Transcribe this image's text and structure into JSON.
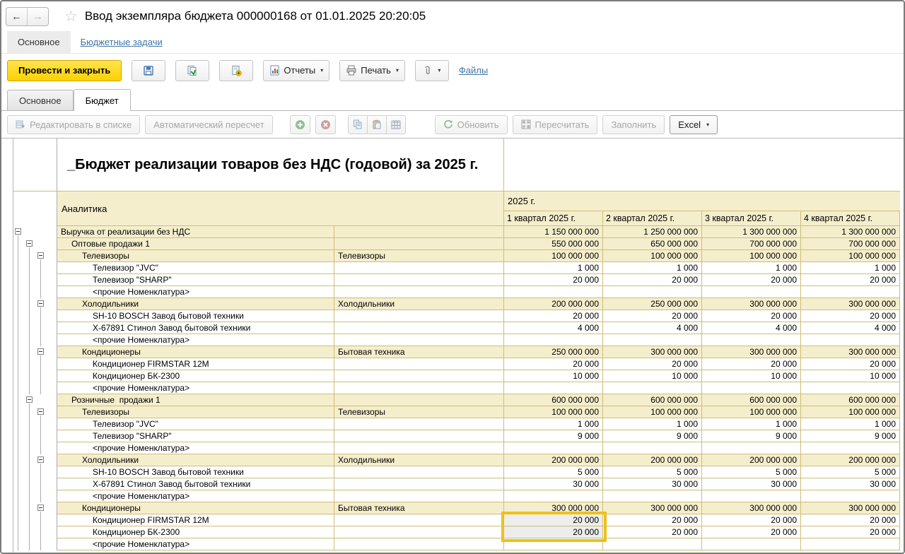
{
  "window": {
    "title": "Ввод экземпляра бюджета 000000168 от 01.01.2025 20:20:05"
  },
  "icons": {
    "back": "←",
    "forward": "→",
    "star": "☆",
    "caret": "▾"
  },
  "nav": {
    "main_tab": "Основное",
    "tasks_link": "Бюджетные задачи"
  },
  "toolbar": {
    "post_close": "Провести и закрыть",
    "reports": "Отчеты",
    "print": "Печать",
    "files": "Файлы"
  },
  "form_tabs": {
    "main": "Основное",
    "budget": "Бюджет"
  },
  "table_toolbar": {
    "edit_list": "Редактировать в списке",
    "auto_recalc": "Автоматический пересчет",
    "refresh": "Обновить",
    "recalc": "Пересчитать",
    "fill": "Заполнить",
    "excel": "Excel"
  },
  "report": {
    "title": "_Бюджет реализации товаров без НДС (годовой) за 2025 г.",
    "analytics": "Аналитика",
    "year": "2025 г.",
    "quarters": [
      "1 квартал 2025 г.",
      "2 квартал 2025 г.",
      "3 квартал 2025 г.",
      "4 квартал 2025 г."
    ]
  },
  "colors": {
    "accent_yellow": "#ffd500",
    "selection_border": "#eec01d",
    "selected_cell_bg": "#ededed",
    "link": "#3e76a8",
    "group_row_bg": "#f5eecd",
    "grid_line": "#ccbe79"
  },
  "selection": {
    "column": "1 квартал 2025 г.",
    "row_labels": [
      "Кондиционер FIRMSTAR 12M",
      "Кондиционер БК-2300"
    ],
    "values": [
      "20 000",
      "20 000"
    ]
  },
  "rows": [
    {
      "t": "Выручка от реализации без НДС",
      "t2": "",
      "v": [
        "1 150 000 000",
        "1 250 000 000",
        "1 300 000 000",
        "1 300 000 000"
      ],
      "lv": 0,
      "g": true,
      "box": 0,
      "pass": []
    },
    {
      "t": "Оптовые продажи 1",
      "t2": "",
      "v": [
        "550 000 000",
        "650 000 000",
        "700 000 000",
        "700 000 000"
      ],
      "lv": 1,
      "g": true,
      "box": 1,
      "pass": [
        0
      ]
    },
    {
      "t": "Телевизоры",
      "t2": "Телевизоры",
      "v": [
        "100 000 000",
        "100 000 000",
        "100 000 000",
        "100 000 000"
      ],
      "lv": 2,
      "g": true,
      "box": 2,
      "pass": [
        0,
        1
      ]
    },
    {
      "t": "Телевизор \"JVC\"",
      "t2": "",
      "v": [
        "1 000",
        "1 000",
        "1 000",
        "1 000"
      ],
      "lv": 3,
      "g": false,
      "box": -1,
      "pass": [
        0,
        1,
        2
      ]
    },
    {
      "t": "Телевизор \"SHARP\"",
      "t2": "",
      "v": [
        "20 000",
        "20 000",
        "20 000",
        "20 000"
      ],
      "lv": 3,
      "g": false,
      "box": -1,
      "pass": [
        0,
        1,
        2
      ]
    },
    {
      "t": "<прочие Номенклатура>",
      "t2": "",
      "v": [
        "",
        "",
        "",
        ""
      ],
      "lv": 3,
      "g": false,
      "box": -1,
      "pass": [
        0,
        1,
        2
      ]
    },
    {
      "t": "Холодильники",
      "t2": "Холодильники",
      "v": [
        "200 000 000",
        "250 000 000",
        "300 000 000",
        "300 000 000"
      ],
      "lv": 2,
      "g": true,
      "box": 2,
      "pass": [
        0,
        1
      ]
    },
    {
      "t": "SH-10 BOSCH Завод бытовой техники",
      "t2": "",
      "v": [
        "20 000",
        "20 000",
        "20 000",
        "20 000"
      ],
      "lv": 3,
      "g": false,
      "box": -1,
      "pass": [
        0,
        1,
        2
      ]
    },
    {
      "t": "X-67891 Стинол Завод бытовой техники",
      "t2": "",
      "v": [
        "4 000",
        "4 000",
        "4 000",
        "4 000"
      ],
      "lv": 3,
      "g": false,
      "box": -1,
      "pass": [
        0,
        1,
        2
      ]
    },
    {
      "t": "<прочие Номенклатура>",
      "t2": "",
      "v": [
        "",
        "",
        "",
        ""
      ],
      "lv": 3,
      "g": false,
      "box": -1,
      "pass": [
        0,
        1,
        2
      ]
    },
    {
      "t": "Кондиционеры",
      "t2": "Бытовая техника",
      "v": [
        "250 000 000",
        "300 000 000",
        "300 000 000",
        "300 000 000"
      ],
      "lv": 2,
      "g": true,
      "box": 2,
      "pass": [
        0,
        1
      ]
    },
    {
      "t": "Кондиционер FIRMSTAR 12M",
      "t2": "",
      "v": [
        "20 000",
        "20 000",
        "20 000",
        "20 000"
      ],
      "lv": 3,
      "g": false,
      "box": -1,
      "pass": [
        0,
        1,
        2
      ]
    },
    {
      "t": "Кондиционер БК-2300",
      "t2": "",
      "v": [
        "10 000",
        "10 000",
        "10 000",
        "10 000"
      ],
      "lv": 3,
      "g": false,
      "box": -1,
      "pass": [
        0,
        1,
        2
      ]
    },
    {
      "t": "<прочие Номенклатура>",
      "t2": "",
      "v": [
        "",
        "",
        "",
        ""
      ],
      "lv": 3,
      "g": false,
      "box": -1,
      "pass": [
        0,
        1,
        2
      ]
    },
    {
      "t": "Розничные  продажи 1",
      "t2": "",
      "v": [
        "600 000 000",
        "600 000 000",
        "600 000 000",
        "600 000 000"
      ],
      "lv": 1,
      "g": true,
      "box": 1,
      "pass": [
        0
      ]
    },
    {
      "t": "Телевизоры",
      "t2": "Телевизоры",
      "v": [
        "100 000 000",
        "100 000 000",
        "100 000 000",
        "100 000 000"
      ],
      "lv": 2,
      "g": true,
      "box": 2,
      "pass": [
        0,
        1
      ]
    },
    {
      "t": "Телевизор \"JVC\"",
      "t2": "",
      "v": [
        "1 000",
        "1 000",
        "1 000",
        "1 000"
      ],
      "lv": 3,
      "g": false,
      "box": -1,
      "pass": [
        0,
        1,
        2
      ]
    },
    {
      "t": "Телевизор \"SHARP\"",
      "t2": "",
      "v": [
        "9 000",
        "9 000",
        "9 000",
        "9 000"
      ],
      "lv": 3,
      "g": false,
      "box": -1,
      "pass": [
        0,
        1,
        2
      ]
    },
    {
      "t": "<прочие Номенклатура>",
      "t2": "",
      "v": [
        "",
        "",
        "",
        ""
      ],
      "lv": 3,
      "g": false,
      "box": -1,
      "pass": [
        0,
        1,
        2
      ]
    },
    {
      "t": "Холодильники",
      "t2": "Холодильники",
      "v": [
        "200 000 000",
        "200 000 000",
        "200 000 000",
        "200 000 000"
      ],
      "lv": 2,
      "g": true,
      "box": 2,
      "pass": [
        0,
        1
      ]
    },
    {
      "t": "SH-10 BOSCH Завод бытовой техники",
      "t2": "",
      "v": [
        "5 000",
        "5 000",
        "5 000",
        "5 000"
      ],
      "lv": 3,
      "g": false,
      "box": -1,
      "pass": [
        0,
        1,
        2
      ]
    },
    {
      "t": "X-67891 Стинол Завод бытовой техники",
      "t2": "",
      "v": [
        "30 000",
        "30 000",
        "30 000",
        "30 000"
      ],
      "lv": 3,
      "g": false,
      "box": -1,
      "pass": [
        0,
        1,
        2
      ]
    },
    {
      "t": "<прочие Номенклатура>",
      "t2": "",
      "v": [
        "",
        "",
        "",
        ""
      ],
      "lv": 3,
      "g": false,
      "box": -1,
      "pass": [
        0,
        1,
        2
      ]
    },
    {
      "t": "Кондиционеры",
      "t2": "Бытовая техника",
      "v": [
        "300 000 000",
        "300 000 000",
        "300 000 000",
        "300 000 000"
      ],
      "lv": 2,
      "g": true,
      "box": 2,
      "pass": [
        0,
        1
      ]
    },
    {
      "t": "Кондиционер FIRMSTAR 12M",
      "t2": "",
      "v": [
        "20 000",
        "20 000",
        "20 000",
        "20 000"
      ],
      "lv": 3,
      "g": false,
      "box": -1,
      "pass": [
        0,
        1,
        2
      ],
      "sel": 0
    },
    {
      "t": "Кондиционер БК-2300",
      "t2": "",
      "v": [
        "20 000",
        "20 000",
        "20 000",
        "20 000"
      ],
      "lv": 3,
      "g": false,
      "box": -1,
      "pass": [
        0,
        1,
        2
      ],
      "sel": 0
    },
    {
      "t": "<прочие Номенклатура>",
      "t2": "",
      "v": [
        "",
        "",
        "",
        ""
      ],
      "lv": 3,
      "g": false,
      "box": -1,
      "pass": [
        0,
        1,
        2
      ]
    }
  ]
}
